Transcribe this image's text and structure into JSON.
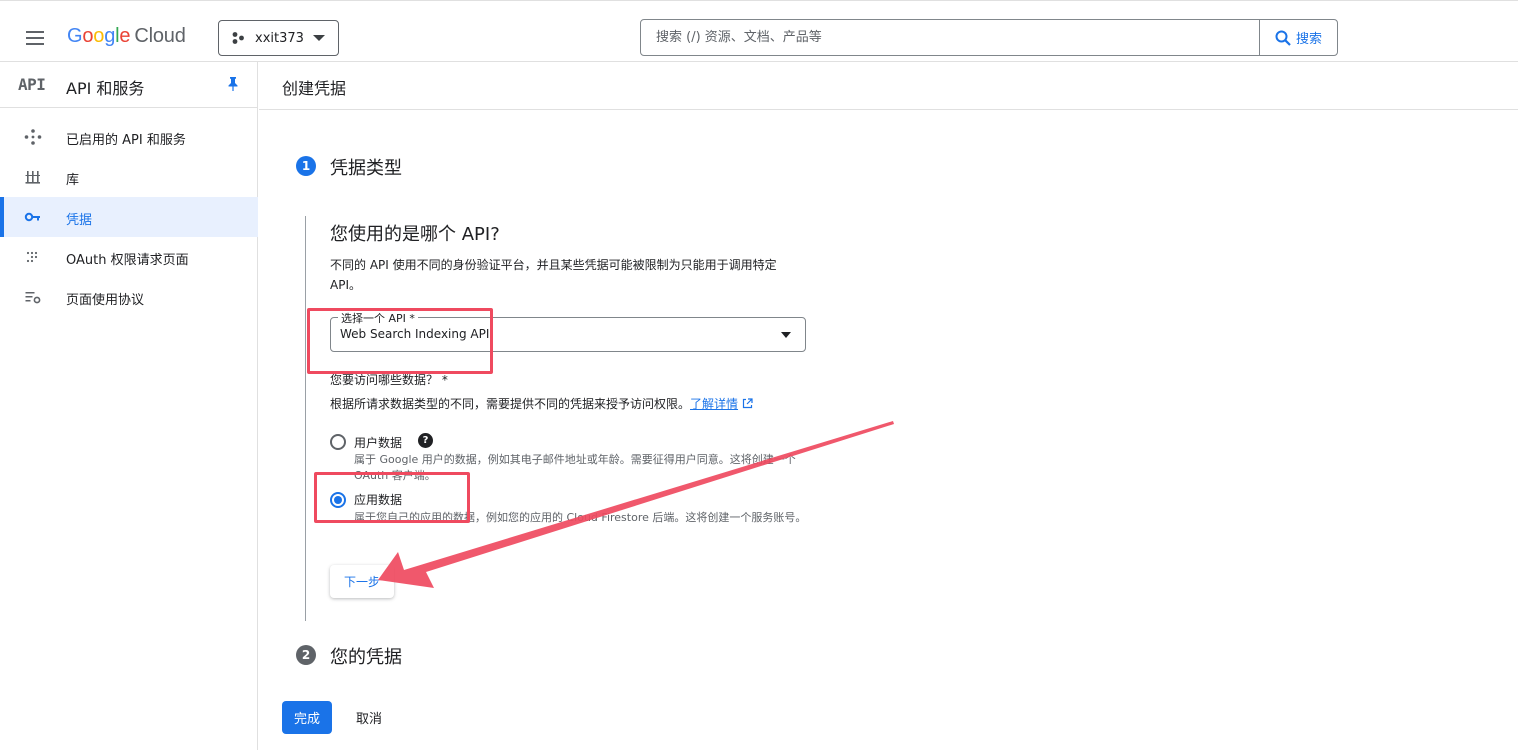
{
  "header": {
    "logo_google": [
      "G",
      "o",
      "o",
      "g",
      "l",
      "e"
    ],
    "logo_cloud": "Cloud",
    "project": "xxit373",
    "search_placeholder": "搜索 (/) 资源、文档、产品等",
    "search_button": "搜索"
  },
  "sidebar": {
    "badge": "API",
    "title": "API 和服务",
    "items": [
      {
        "label": "已启用的 API 和服务",
        "icon": "diamond-nodes-icon"
      },
      {
        "label": "库",
        "icon": "library-icon"
      },
      {
        "label": "凭据",
        "icon": "key-icon",
        "active": true
      },
      {
        "label": "OAuth 权限请求页面",
        "icon": "dotted-grid-icon"
      },
      {
        "label": "页面使用协议",
        "icon": "list-settings-icon"
      }
    ]
  },
  "page": {
    "title": "创建凭据",
    "step1": {
      "number": "1",
      "title": "凭据类型"
    },
    "question": "您使用的是哪个 API?",
    "description": "不同的 API 使用不同的身份验证平台，并且某些凭据可能被限制为只能用于调用特定 API。",
    "select": {
      "legend": "选择一个 API *",
      "value": "Web Search Indexing API"
    },
    "data_question": "您要访问哪些数据？ *",
    "data_description": "根据所请求数据类型的不同，需要提供不同的凭据来授予访问权限。",
    "learn_more": "了解详情",
    "options": [
      {
        "label": "用户数据",
        "desc": "属于 Google 用户的数据，例如其电子邮件地址或年龄。需要征得用户同意。这将创建一个 OAuth 客户端。",
        "checked": false
      },
      {
        "label": "应用数据",
        "desc": "属于您自己的应用的数据，例如您的应用的 Cloud Firestore 后端。这将创建一个服务账号。",
        "checked": true
      }
    ],
    "next_button": "下一步",
    "step2": {
      "number": "2",
      "title": "您的凭据"
    },
    "done_button": "完成",
    "cancel_button": "取消"
  },
  "colors": {
    "accent": "#1a73e8",
    "annotation": "#ef4a5f",
    "step_inactive": "#5f6368"
  }
}
